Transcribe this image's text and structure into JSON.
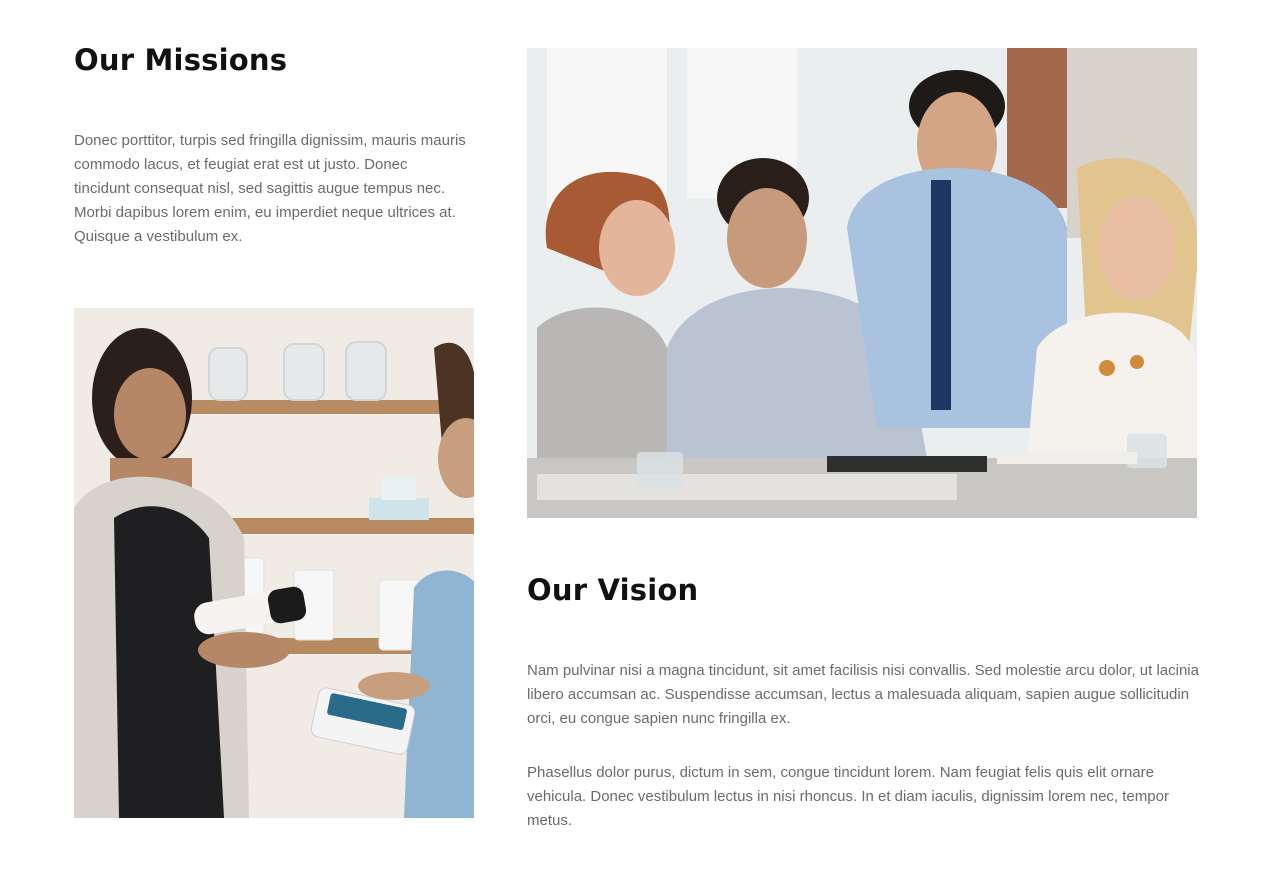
{
  "missions": {
    "title": "Our Missions",
    "text": "Donec porttitor, turpis sed fringilla dignissim, mauris mauris commodo lacus, et feugiat erat est ut justo. Donec tincidunt consequat nisl, sed sagittis augue tempus nec. Morbi dapibus lorem enim, eu imperdiet neque ultrices at. Quisque a vestibulum ex."
  },
  "vision": {
    "title": "Our Vision",
    "paragraphs": [
      "Nam pulvinar nisi a magna tincidunt, sit amet facilisis nisi convallis. Sed molestie arcu dolor, ut lacinia libero accumsan ac. Suspendisse accumsan, lectus a malesuada aliquam, sapien augue sollicitudin orci, eu congue sapien nunc fringilla ex.",
      "Phasellus dolor purus, dictum in sem, congue tincidunt lorem. Nam feugiat felis quis elit ornare vehicula. Donec vestibulum lectus in nisi rhoncus. In et diam iaculis, dignissim lorem nec, tempor metus."
    ]
  },
  "images": {
    "shop_photo": "shop-payment-photo",
    "meeting_photo": "team-meeting-photo"
  },
  "colors": {
    "heading": "#111111",
    "body_text": "#6b6b6b",
    "background": "#ffffff"
  }
}
